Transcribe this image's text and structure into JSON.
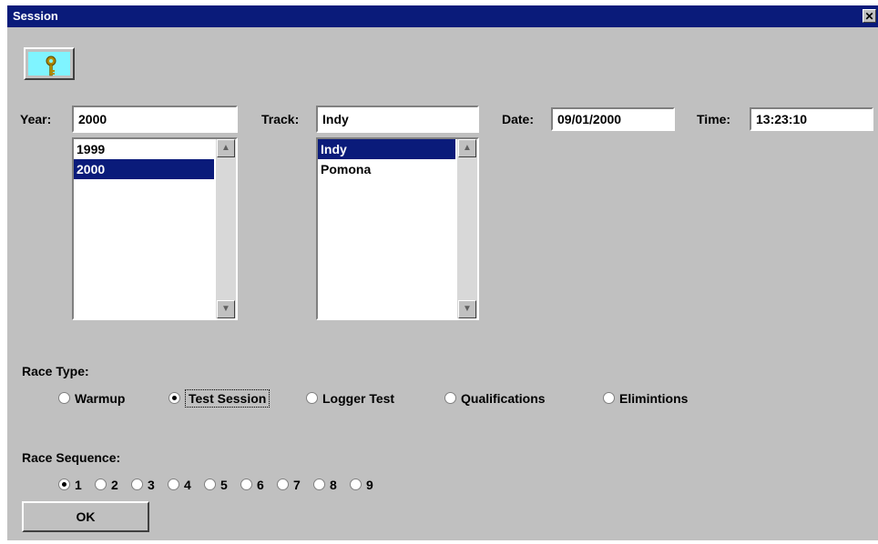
{
  "window": {
    "title": "Session",
    "close_glyph": "✕"
  },
  "toolbar": {
    "key_icon": "key-icon",
    "key_glyph": "🔑"
  },
  "year": {
    "label": "Year:",
    "value": "2000",
    "options": [
      {
        "label": "1999",
        "selected": false
      },
      {
        "label": "2000",
        "selected": true
      }
    ]
  },
  "track": {
    "label": "Track:",
    "value": "Indy",
    "options": [
      {
        "label": "Indy",
        "selected": true
      },
      {
        "label": "Pomona",
        "selected": false
      }
    ]
  },
  "date": {
    "label": "Date:",
    "value": "09/01/2000"
  },
  "time": {
    "label": "Time:",
    "value": "13:23:10"
  },
  "race_type": {
    "label": "Race Type:",
    "options": [
      {
        "label": "Warmup",
        "selected": false
      },
      {
        "label": "Test Session",
        "selected": true
      },
      {
        "label": "Logger Test",
        "selected": false
      },
      {
        "label": "Qualifications",
        "selected": false
      },
      {
        "label": "Elimintions",
        "selected": false
      }
    ]
  },
  "race_sequence": {
    "label": "Race Sequence:",
    "options": [
      {
        "label": "1",
        "selected": true
      },
      {
        "label": "2",
        "selected": false
      },
      {
        "label": "3",
        "selected": false
      },
      {
        "label": "4",
        "selected": false
      },
      {
        "label": "5",
        "selected": false
      },
      {
        "label": "6",
        "selected": false
      },
      {
        "label": "7",
        "selected": false
      },
      {
        "label": "8",
        "selected": false
      },
      {
        "label": "9",
        "selected": false
      }
    ]
  },
  "ok_button": {
    "label": "OK"
  },
  "colors": {
    "titlebar": "#0a1b7a",
    "face": "#c0c0c0",
    "key_button": "#7ff4ff",
    "selection": "#0a1b7a"
  }
}
